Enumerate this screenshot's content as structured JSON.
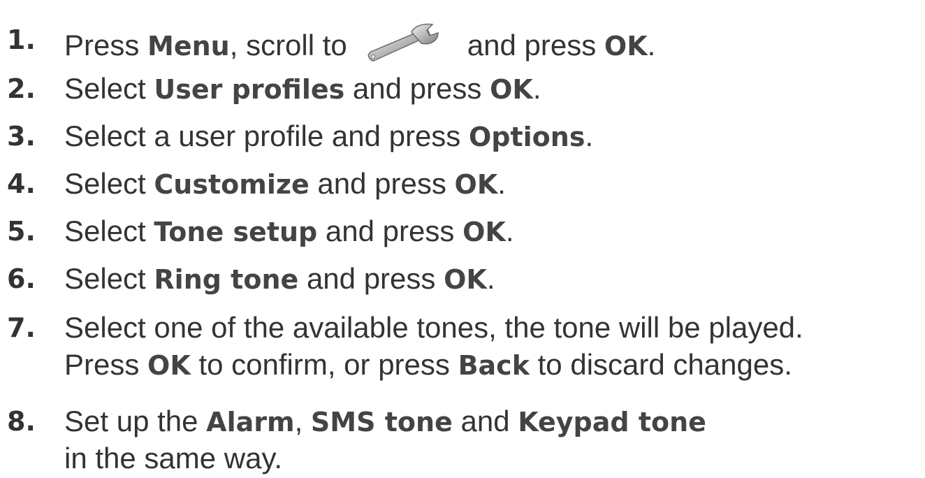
{
  "steps": [
    {
      "number": "1.",
      "segments": [
        {
          "t": "Press "
        },
        {
          "b": "Menu"
        },
        {
          "t": ", scroll to"
        },
        {
          "icon": "wrench-icon"
        },
        {
          "t": "and press "
        },
        {
          "b": "OK"
        },
        {
          "t": "."
        }
      ]
    },
    {
      "number": "2.",
      "segments": [
        {
          "t": "Select "
        },
        {
          "b": "User profiles"
        },
        {
          "t": " and press "
        },
        {
          "b": "OK"
        },
        {
          "t": "."
        }
      ]
    },
    {
      "number": "3.",
      "segments": [
        {
          "t": "Select a user profile and press "
        },
        {
          "b": "Options"
        },
        {
          "t": "."
        }
      ]
    },
    {
      "number": "4.",
      "segments": [
        {
          "t": "Select "
        },
        {
          "b": "Customize"
        },
        {
          "t": " and press "
        },
        {
          "b": "OK"
        },
        {
          "t": "."
        }
      ]
    },
    {
      "number": "5.",
      "segments": [
        {
          "t": "Select "
        },
        {
          "b": "Tone setup"
        },
        {
          "t": " and press "
        },
        {
          "b": "OK"
        },
        {
          "t": "."
        }
      ]
    },
    {
      "number": "6.",
      "segments": [
        {
          "t": "Select "
        },
        {
          "b": "Ring tone"
        },
        {
          "t": " and press "
        },
        {
          "b": "OK"
        },
        {
          "t": "."
        }
      ]
    },
    {
      "number": "7.",
      "lines": [
        [
          {
            "t": "Select one of the available tones, the tone will be played."
          }
        ],
        [
          {
            "t": "Press "
          },
          {
            "b": "OK"
          },
          {
            "t": " to confirm, or press "
          },
          {
            "b": "Back"
          },
          {
            "t": " to discard changes."
          }
        ]
      ]
    },
    {
      "number": "8.",
      "lines": [
        [
          {
            "t": "Set up the "
          },
          {
            "b": "Alarm"
          },
          {
            "t": ", "
          },
          {
            "b": "SMS tone"
          },
          {
            "t": " and "
          },
          {
            "b": "Keypad tone"
          }
        ],
        [
          {
            "t": "in the same way."
          }
        ]
      ]
    }
  ]
}
